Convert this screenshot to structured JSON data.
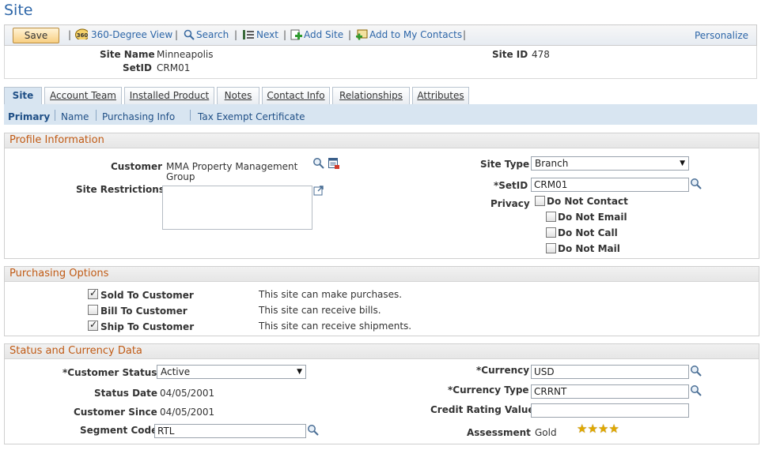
{
  "page": {
    "title": "Site"
  },
  "toolbar": {
    "save": "Save",
    "view360": "360-Degree View",
    "search": "Search",
    "next": "Next",
    "add_site": "Add Site",
    "add_contacts": "Add to My Contacts",
    "personalize": "Personalize",
    "separator": "|"
  },
  "header": {
    "site_name_label": "Site Name",
    "site_name_value": "Minneapolis",
    "setid_label": "SetID",
    "setid_value": "CRM01",
    "site_id_label": "Site ID",
    "site_id_value": "478"
  },
  "tabs": [
    "Site",
    "Account Team",
    "Installed Product",
    "Notes",
    "Contact Info",
    "Relationships",
    "Attributes"
  ],
  "subnav": [
    "Primary",
    "Name",
    "Purchasing Info",
    "Tax Exempt Certificate"
  ],
  "profile": {
    "title": "Profile Information",
    "customer_label": "Customer",
    "customer_value_line1": "MMA Property Management",
    "customer_value_line2": "Group",
    "site_restrictions_label": "Site Restrictions",
    "site_type_label": "Site Type",
    "site_type_value": "Branch",
    "setid_label": "*SetID",
    "setid_value": "CRM01",
    "privacy_label": "Privacy",
    "do_not_contact": "Do Not Contact",
    "do_not_email": "Do Not Email",
    "do_not_call": "Do Not Call",
    "do_not_mail": "Do Not Mail"
  },
  "purchasing": {
    "title": "Purchasing Options",
    "sold_label": "Sold To Customer",
    "sold_desc": "This site can make purchases.",
    "sold_checked": true,
    "bill_label": "Bill To Customer",
    "bill_desc": "This site can receive bills.",
    "bill_checked": false,
    "ship_label": "Ship To Customer",
    "ship_desc": "This site can receive shipments.",
    "ship_checked": true
  },
  "status": {
    "title": "Status and Currency Data",
    "customer_status_label": "*Customer Status",
    "customer_status_value": "Active",
    "status_date_label": "Status Date",
    "status_date_value": "04/05/2001",
    "customer_since_label": "Customer Since",
    "customer_since_value": "04/05/2001",
    "segment_code_label": "Segment Code",
    "segment_code_value": "RTL",
    "currency_label": "*Currency",
    "currency_value": "USD",
    "currency_type_label": "*Currency Type",
    "currency_type_value": "CRRNT",
    "credit_rating_label": "Credit Rating Value",
    "credit_rating_value": "",
    "assessment_label": "Assessment",
    "assessment_value": "Gold",
    "assessment_stars": 4
  },
  "colors": {
    "link": "#2d66a8",
    "group_title": "#c05a14",
    "subnav_bg": "#d8e5f1",
    "star": "#e0a800"
  },
  "icons": [
    "360-icon",
    "search-icon",
    "next-icon",
    "add-site-icon",
    "add-contact-icon",
    "lookup-icon",
    "calendar-detail-icon",
    "expand-icon",
    "star-icon"
  ]
}
